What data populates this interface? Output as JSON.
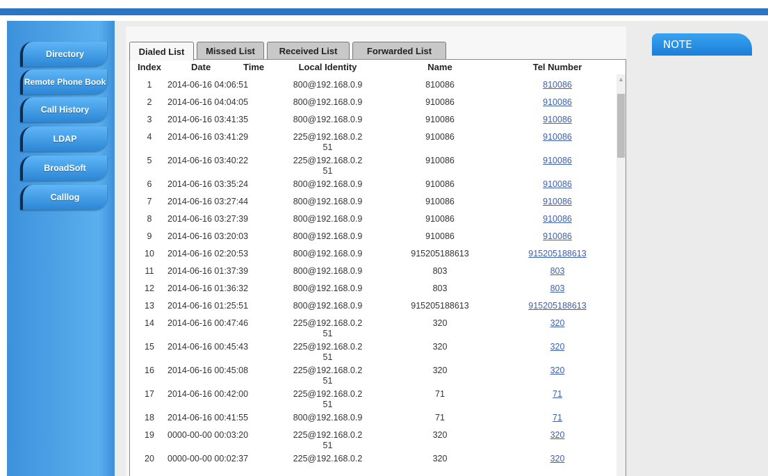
{
  "sidebar": {
    "items": [
      {
        "label": "Directory"
      },
      {
        "label": "Remote Phone Book"
      },
      {
        "label": "Call History"
      },
      {
        "label": "LDAP"
      },
      {
        "label": "BroadSoft"
      },
      {
        "label": "Calllog"
      }
    ]
  },
  "tabs": [
    {
      "label": "Dialed List",
      "active": true
    },
    {
      "label": "Missed List"
    },
    {
      "label": "Received List"
    },
    {
      "label": "Forwarded List"
    }
  ],
  "table": {
    "headers": {
      "index": "Index",
      "date": "Date",
      "time": "Time",
      "local_identity": "Local Identity",
      "name": "Name",
      "tel": "Tel Number"
    },
    "rows": [
      {
        "index": "1",
        "datetime": "2014-06-16 04:06:51",
        "local": "800@192.168.0.9",
        "name": "810086",
        "tel": "810086"
      },
      {
        "index": "2",
        "datetime": "2014-06-16 04:04:05",
        "local": "800@192.168.0.9",
        "name": "910086",
        "tel": "910086"
      },
      {
        "index": "3",
        "datetime": "2014-06-16 03:41:35",
        "local": "800@192.168.0.9",
        "name": "910086",
        "tel": "910086"
      },
      {
        "index": "4",
        "datetime": "2014-06-16 03:41:29",
        "local": "225@192.168.0.2\n51",
        "name": "910086",
        "tel": "910086"
      },
      {
        "index": "5",
        "datetime": "2014-06-16 03:40:22",
        "local": "225@192.168.0.2\n51",
        "name": "910086",
        "tel": "910086"
      },
      {
        "index": "6",
        "datetime": "2014-06-16 03:35:24",
        "local": "800@192.168.0.9",
        "name": "910086",
        "tel": "910086"
      },
      {
        "index": "7",
        "datetime": "2014-06-16 03:27:44",
        "local": "800@192.168.0.9",
        "name": "910086",
        "tel": "910086"
      },
      {
        "index": "8",
        "datetime": "2014-06-16 03:27:39",
        "local": "800@192.168.0.9",
        "name": "910086",
        "tel": "910086"
      },
      {
        "index": "9",
        "datetime": "2014-06-16 03:20:03",
        "local": "800@192.168.0.9",
        "name": "910086",
        "tel": "910086"
      },
      {
        "index": "10",
        "datetime": "2014-06-16 02:20:53",
        "local": "800@192.168.0.9",
        "name": "915205188613",
        "tel": "915205188613"
      },
      {
        "index": "11",
        "datetime": "2014-06-16 01:37:39",
        "local": "800@192.168.0.9",
        "name": "803",
        "tel": "803"
      },
      {
        "index": "12",
        "datetime": "2014-06-16 01:36:32",
        "local": "800@192.168.0.9",
        "name": "803",
        "tel": "803"
      },
      {
        "index": "13",
        "datetime": "2014-06-16 01:25:51",
        "local": "800@192.168.0.9",
        "name": "915205188613",
        "tel": "915205188613"
      },
      {
        "index": "14",
        "datetime": "2014-06-16 00:47:46",
        "local": "225@192.168.0.2\n51",
        "name": "320",
        "tel": "320"
      },
      {
        "index": "15",
        "datetime": "2014-06-16 00:45:43",
        "local": "225@192.168.0.2\n51",
        "name": "320",
        "tel": "320"
      },
      {
        "index": "16",
        "datetime": "2014-06-16 00:45:08",
        "local": "225@192.168.0.2\n51",
        "name": "320",
        "tel": "320"
      },
      {
        "index": "17",
        "datetime": "2014-06-16 00:42:00",
        "local": "225@192.168.0.2\n51",
        "name": "71",
        "tel": "71"
      },
      {
        "index": "18",
        "datetime": "2014-06-16 00:41:55",
        "local": "800@192.168.0.9",
        "name": "71",
        "tel": "71"
      },
      {
        "index": "19",
        "datetime": "0000-00-00 00:03:20",
        "local": "225@192.168.0.2\n51",
        "name": "320",
        "tel": "320"
      },
      {
        "index": "20",
        "datetime": "0000-00-00 00:02:37",
        "local": "225@192.168.0.2",
        "name": "320",
        "tel": "320"
      }
    ]
  },
  "note": {
    "title": "NOTE"
  },
  "colors": {
    "accent": "#2b74c4",
    "sidebar": "#3d91dc",
    "link": "#3b5fb0"
  }
}
